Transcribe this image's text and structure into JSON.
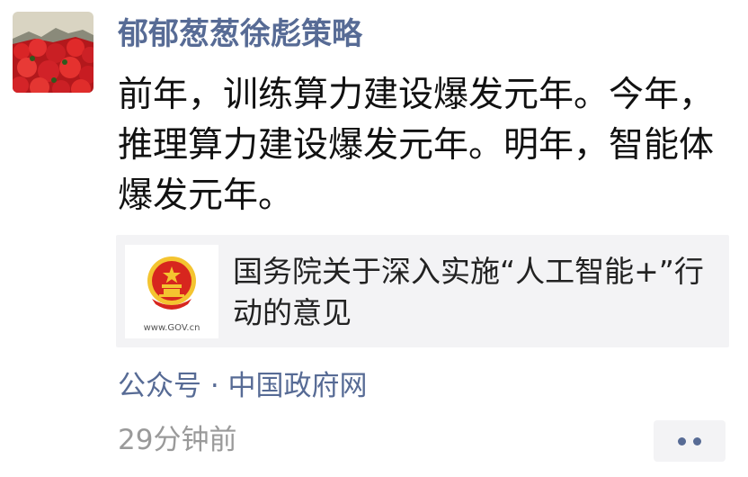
{
  "post": {
    "author": "郁郁葱葱徐彪策略",
    "text": "前年，训练算力建设爆发元年。今年，推理算力建设爆发元年。明年，智能体爆发元年。"
  },
  "link_card": {
    "title": "国务院关于深入实施“人工智能+”行动的意见",
    "thumb_icon": "national-emblem-icon",
    "thumb_caption": "www.GOV.cn"
  },
  "source": {
    "label": "公众号 · 中国政府网"
  },
  "meta": {
    "timestamp": "29分钟前",
    "more_icon": "more-dots-icon"
  },
  "colors": {
    "name_blue": "#576b95",
    "text": "#111111",
    "muted": "#9a9a9a",
    "card_bg": "#f3f3f5",
    "emblem_red": "#d7261e",
    "emblem_gold": "#f4c430"
  }
}
